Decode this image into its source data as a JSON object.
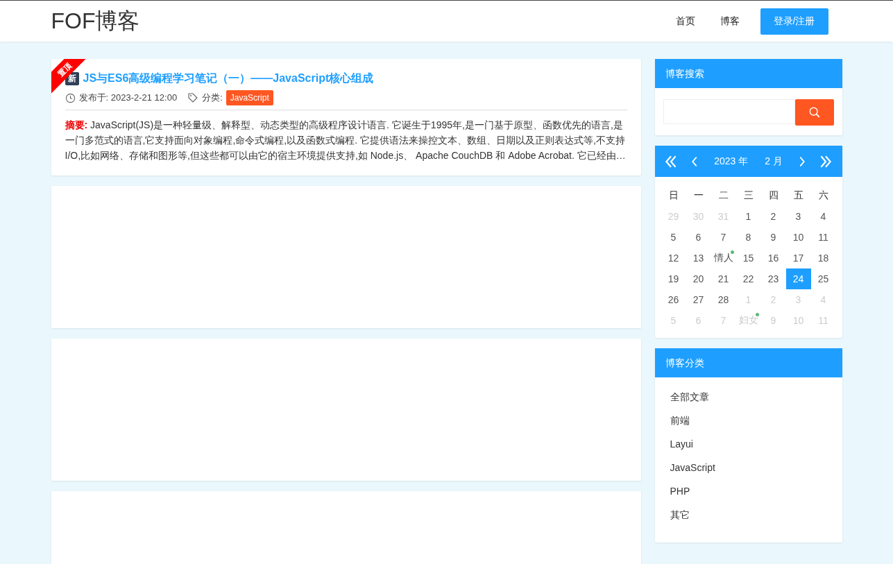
{
  "header": {
    "logo": "FOF博客",
    "nav": [
      {
        "label": "首页"
      },
      {
        "label": "博客"
      }
    ],
    "login_button": "登录/注册"
  },
  "posts": [
    {
      "ribbon": "置顶",
      "badge": "新",
      "title": "JS与ES6高级编程学习笔记（一）——JavaScript核心组成",
      "published": "发布于: 2023-2-21 12:00",
      "category_label": "分类:",
      "category": "JavaScript",
      "summary": "**摘要:** JavaScript(JS)是一种轻量级、解释型、动态类型的高级程序设计语言. 它诞生于1995年,是一门基于原型、函数优先的语言,是一门多范式的语言,它支持面向对象编程,命令式编程,以及函数式编程. 它提供语法来操控文本、数组、日期以及正则表达式等,不支持I/O,比如网络、存储和图形等,但这些都可以由它的宿主环境提供支持,如 Node.js、 Apache CouchDB 和 Adobe Acrobat. 它已经由…"
    }
  ],
  "search": {
    "title": "博客搜索"
  },
  "calendar": {
    "year": "2023 年",
    "month": "2 月",
    "weekdays": [
      "日",
      "一",
      "二",
      "三",
      "四",
      "五",
      "六"
    ],
    "days": [
      {
        "text": "29",
        "other_month": true,
        "selected": false,
        "marked": false
      },
      {
        "text": "30",
        "other_month": true,
        "selected": false,
        "marked": false
      },
      {
        "text": "31",
        "other_month": true,
        "selected": false,
        "marked": false
      },
      {
        "text": "1",
        "other_month": false,
        "selected": false,
        "marked": false
      },
      {
        "text": "2",
        "other_month": false,
        "selected": false,
        "marked": false
      },
      {
        "text": "3",
        "other_month": false,
        "selected": false,
        "marked": false
      },
      {
        "text": "4",
        "other_month": false,
        "selected": false,
        "marked": false
      },
      {
        "text": "5",
        "other_month": false,
        "selected": false,
        "marked": false
      },
      {
        "text": "6",
        "other_month": false,
        "selected": false,
        "marked": false
      },
      {
        "text": "7",
        "other_month": false,
        "selected": false,
        "marked": false
      },
      {
        "text": "8",
        "other_month": false,
        "selected": false,
        "marked": false
      },
      {
        "text": "9",
        "other_month": false,
        "selected": false,
        "marked": false
      },
      {
        "text": "10",
        "other_month": false,
        "selected": false,
        "marked": false
      },
      {
        "text": "11",
        "other_month": false,
        "selected": false,
        "marked": false
      },
      {
        "text": "12",
        "other_month": false,
        "selected": false,
        "marked": false
      },
      {
        "text": "13",
        "other_month": false,
        "selected": false,
        "marked": false
      },
      {
        "text": "情人",
        "other_month": false,
        "selected": false,
        "marked": true
      },
      {
        "text": "15",
        "other_month": false,
        "selected": false,
        "marked": false
      },
      {
        "text": "16",
        "other_month": false,
        "selected": false,
        "marked": false
      },
      {
        "text": "17",
        "other_month": false,
        "selected": false,
        "marked": false
      },
      {
        "text": "18",
        "other_month": false,
        "selected": false,
        "marked": false
      },
      {
        "text": "19",
        "other_month": false,
        "selected": false,
        "marked": false
      },
      {
        "text": "20",
        "other_month": false,
        "selected": false,
        "marked": false
      },
      {
        "text": "21",
        "other_month": false,
        "selected": false,
        "marked": false
      },
      {
        "text": "22",
        "other_month": false,
        "selected": false,
        "marked": false
      },
      {
        "text": "23",
        "other_month": false,
        "selected": false,
        "marked": false
      },
      {
        "text": "24",
        "other_month": false,
        "selected": true,
        "marked": false
      },
      {
        "text": "25",
        "other_month": false,
        "selected": false,
        "marked": false
      },
      {
        "text": "26",
        "other_month": false,
        "selected": false,
        "marked": false
      },
      {
        "text": "27",
        "other_month": false,
        "selected": false,
        "marked": false
      },
      {
        "text": "28",
        "other_month": false,
        "selected": false,
        "marked": false
      },
      {
        "text": "1",
        "other_month": true,
        "selected": false,
        "marked": false
      },
      {
        "text": "2",
        "other_month": true,
        "selected": false,
        "marked": false
      },
      {
        "text": "3",
        "other_month": true,
        "selected": false,
        "marked": false
      },
      {
        "text": "4",
        "other_month": true,
        "selected": false,
        "marked": false
      },
      {
        "text": "5",
        "other_month": true,
        "selected": false,
        "marked": false
      },
      {
        "text": "6",
        "other_month": true,
        "selected": false,
        "marked": false
      },
      {
        "text": "7",
        "other_month": true,
        "selected": false,
        "marked": false
      },
      {
        "text": "妇女",
        "other_month": true,
        "selected": false,
        "marked": true
      },
      {
        "text": "9",
        "other_month": true,
        "selected": false,
        "marked": false
      },
      {
        "text": "10",
        "other_month": true,
        "selected": false,
        "marked": false
      },
      {
        "text": "11",
        "other_month": true,
        "selected": false,
        "marked": false
      }
    ]
  },
  "categories": {
    "title": "博客分类",
    "items": [
      {
        "label": "全部文章"
      },
      {
        "label": "前端"
      },
      {
        "label": "Layui"
      },
      {
        "label": "JavaScript"
      },
      {
        "label": "PHP"
      },
      {
        "label": "其它"
      }
    ]
  }
}
